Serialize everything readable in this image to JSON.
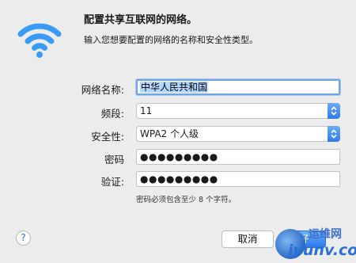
{
  "dialog": {
    "title": "配置共享互联网的网络。",
    "subtitle": "输入您想要配置的网络的名称和安全性类型。"
  },
  "form": {
    "network_name_label": "网络名称:",
    "network_name_value": "中华人民共和国",
    "channel_label": "频段:",
    "channel_value": "11",
    "security_label": "安全性:",
    "security_value": "WPA2 个人级",
    "password_label": "密码",
    "password_value": "●●●●●●●●●",
    "verify_label": "验证:",
    "verify_value": "●●●●●●●●●",
    "hint": "密码必须包含至少 8 个字符。"
  },
  "buttons": {
    "help_label": "?",
    "cancel_label": "取消",
    "join_label": "好"
  },
  "watermark": {
    "cn": "运维网",
    "en": "iyunv.com"
  },
  "colors": {
    "wifi": "#3a9bf4",
    "accent": "#2f7bea",
    "focus_ring": "#71a4e4"
  }
}
